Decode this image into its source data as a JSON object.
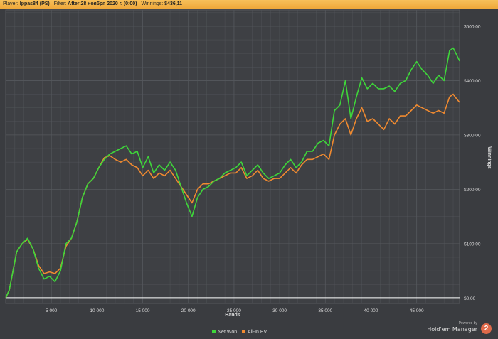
{
  "header": {
    "player_label": "Player:",
    "player_value": "Ippas84 (PS)",
    "filter_label": "Filter:",
    "filter_value": "After 28 ноября 2020 г. (0:00)",
    "winnings_label": "Winnings:",
    "winnings_value": "$436,11"
  },
  "brand": {
    "powered": "Powered by",
    "name": "Hold'em Manager",
    "badge": "2"
  },
  "colors": {
    "net_won": "#3ed63a",
    "all_in_ev": "#f08a30",
    "zero_line": "#ffffff",
    "grid": "#55585d",
    "axis_text": "#dddddd"
  },
  "chart_data": {
    "type": "line",
    "xlabel": "Hands",
    "ylabel": "Winnings",
    "xlim": [
      0,
      49700
    ],
    "ylim": [
      -10,
      530
    ],
    "x_ticks": [
      5000,
      10000,
      15000,
      20000,
      25000,
      30000,
      35000,
      40000,
      45000
    ],
    "x_tick_labels": [
      "5 000",
      "10 000",
      "15 000",
      "20 000",
      "25 000",
      "30 000",
      "35 000",
      "40 000",
      "45 000"
    ],
    "y_ticks": [
      0,
      100,
      200,
      300,
      400,
      500
    ],
    "y_tick_labels": [
      "$0,00",
      "$100,00",
      "$200,00",
      "$300,00",
      "$400,00",
      "$500,00"
    ],
    "y_axis_side": "right",
    "grid": true,
    "legend_position": "bottom-center",
    "series": [
      {
        "name": "Net Won",
        "x": [
          0,
          400,
          800,
          1200,
          1800,
          2400,
          3000,
          3600,
          4200,
          4800,
          5400,
          6000,
          6600,
          7200,
          7800,
          8400,
          9000,
          9600,
          10200,
          10800,
          11400,
          12000,
          12600,
          13200,
          13800,
          14400,
          15000,
          15600,
          16200,
          16800,
          17400,
          18000,
          18600,
          19200,
          19800,
          20400,
          21000,
          21600,
          22200,
          22800,
          23400,
          24000,
          24600,
          25200,
          25800,
          26400,
          27000,
          27600,
          28200,
          28800,
          29400,
          30000,
          30600,
          31200,
          31800,
          32400,
          33000,
          33600,
          34200,
          34800,
          35400,
          36000,
          36600,
          37200,
          37800,
          38400,
          39000,
          39600,
          40200,
          40800,
          41400,
          42000,
          42600,
          43200,
          43800,
          44400,
          45000,
          45600,
          46200,
          46800,
          47400,
          48000,
          48600,
          49000,
          49300,
          49700
        ],
        "y": [
          0,
          15,
          50,
          85,
          100,
          110,
          90,
          55,
          35,
          40,
          30,
          50,
          100,
          110,
          140,
          185,
          210,
          220,
          240,
          255,
          265,
          270,
          275,
          280,
          265,
          270,
          240,
          260,
          230,
          245,
          235,
          250,
          235,
          205,
          175,
          150,
          185,
          200,
          205,
          215,
          220,
          230,
          235,
          240,
          250,
          225,
          235,
          245,
          230,
          220,
          225,
          230,
          245,
          255,
          240,
          250,
          270,
          270,
          285,
          290,
          280,
          345,
          355,
          400,
          330,
          370,
          405,
          385,
          395,
          385,
          385,
          390,
          380,
          395,
          400,
          420,
          435,
          420,
          410,
          395,
          410,
          400,
          455,
          460,
          450,
          436
        ]
      },
      {
        "name": "All-In EV",
        "x": [
          0,
          400,
          800,
          1200,
          1800,
          2400,
          3000,
          3600,
          4200,
          4800,
          5400,
          6000,
          6600,
          7200,
          7800,
          8400,
          9000,
          9600,
          10200,
          10800,
          11400,
          12000,
          12600,
          13200,
          13800,
          14400,
          15000,
          15600,
          16200,
          16800,
          17400,
          18000,
          18600,
          19200,
          19800,
          20400,
          21000,
          21600,
          22200,
          22800,
          23400,
          24000,
          24600,
          25200,
          25800,
          26400,
          27000,
          27600,
          28200,
          28800,
          29400,
          30000,
          30600,
          31200,
          31800,
          32400,
          33000,
          33600,
          34200,
          34800,
          35400,
          36000,
          36600,
          37200,
          37800,
          38400,
          39000,
          39600,
          40200,
          40800,
          41400,
          42000,
          42600,
          43200,
          43800,
          44400,
          45000,
          45600,
          46200,
          46800,
          47400,
          48000,
          48600,
          49000,
          49300,
          49700
        ],
        "y": [
          0,
          15,
          50,
          85,
          100,
          108,
          90,
          60,
          45,
          48,
          45,
          55,
          95,
          110,
          140,
          185,
          210,
          220,
          240,
          258,
          262,
          255,
          250,
          255,
          245,
          240,
          225,
          235,
          220,
          230,
          225,
          235,
          220,
          205,
          190,
          175,
          200,
          210,
          210,
          215,
          220,
          225,
          230,
          230,
          240,
          220,
          225,
          235,
          220,
          215,
          220,
          220,
          230,
          240,
          230,
          245,
          255,
          255,
          260,
          265,
          255,
          300,
          320,
          330,
          300,
          330,
          350,
          325,
          330,
          320,
          310,
          330,
          320,
          335,
          335,
          345,
          355,
          350,
          345,
          340,
          345,
          340,
          370,
          375,
          368,
          360
        ]
      }
    ]
  }
}
